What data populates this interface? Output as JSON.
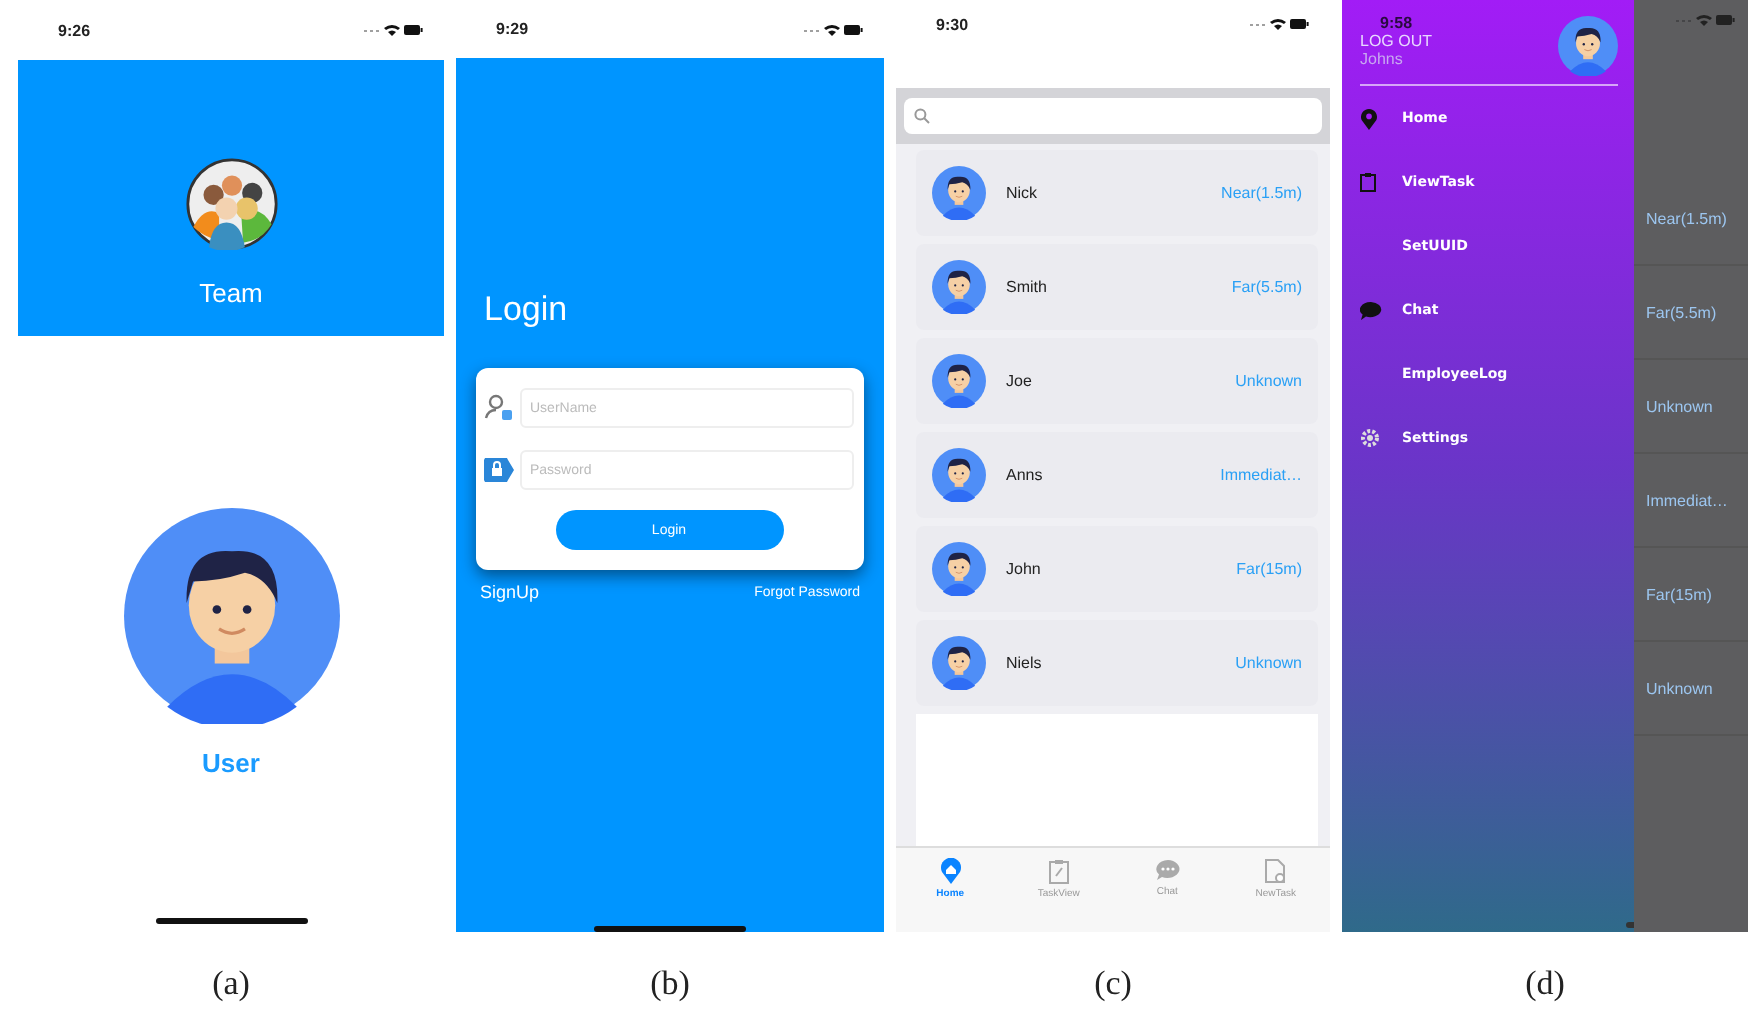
{
  "panels": [
    {
      "kind": "roles",
      "caption": "(a)",
      "time": "9:26",
      "team": {
        "label": "Team"
      },
      "user": {
        "label": "User"
      }
    },
    {
      "kind": "login",
      "caption": "(b)",
      "time": "9:29",
      "title": "Login",
      "username": {
        "placeholder": "UserName"
      },
      "password": {
        "placeholder": "Password"
      },
      "button": "Login",
      "signup": "SignUp",
      "forgot": "Forgot Password"
    },
    {
      "kind": "list",
      "caption": "(c)",
      "time": "9:30",
      "people": [
        {
          "name": "Nick",
          "distance": "Near(1.5m)"
        },
        {
          "name": "Smith",
          "distance": "Far(5.5m)"
        },
        {
          "name": "Joe",
          "distance": "Unknown"
        },
        {
          "name": "Anns",
          "distance": "Immediat…"
        },
        {
          "name": "John",
          "distance": "Far(15m)"
        },
        {
          "name": "Niels",
          "distance": "Unknown"
        }
      ],
      "tabs": [
        {
          "label": "Home",
          "selected": true
        },
        {
          "label": "TaskView",
          "selected": false
        },
        {
          "label": "Chat",
          "selected": false
        },
        {
          "label": "NewTask",
          "selected": false
        }
      ]
    },
    {
      "kind": "drawer",
      "caption": "(d)",
      "time": "9:58",
      "logout": "LOG OUT",
      "user": "Johns",
      "menu": [
        {
          "label": "Home",
          "kind": "location"
        },
        {
          "label": "ViewTask",
          "kind": "task"
        },
        {
          "label": "SetUUID",
          "kind": "plain"
        },
        {
          "label": "Chat",
          "kind": "chat"
        },
        {
          "label": "EmployeeLog",
          "kind": "plain"
        },
        {
          "label": "Settings",
          "kind": "settings"
        }
      ],
      "background_distances": [
        "Near(1.5m)",
        "Far(5.5m)",
        "Unknown",
        "Immediat…",
        "Far(15m)",
        "Unknown"
      ]
    }
  ]
}
